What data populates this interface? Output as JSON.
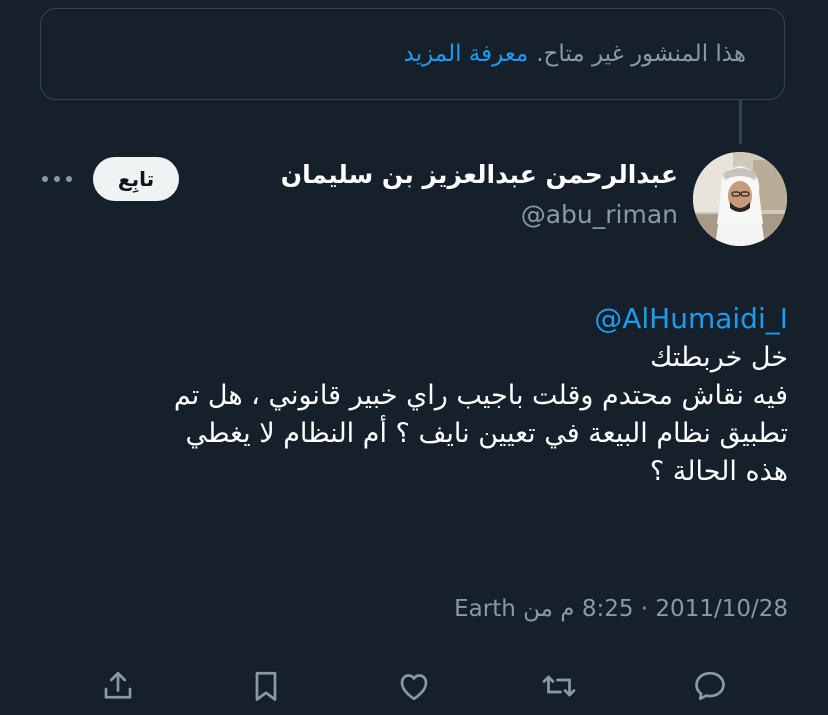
{
  "notice": {
    "message": "هذا المنشور غير متاح.",
    "link_label": "معرفة المزيد"
  },
  "author": {
    "display_name": "عبدالرحمن عبدالعزيز بن سليمان",
    "handle": "@abu_riman"
  },
  "follow_label": "تابِع",
  "more_icon": "more-horizontal-icon",
  "tweet": {
    "mention": "@AlHumaidi_I",
    "lines": [
      "خل خربطتك",
      "فيه نقاش محتدم وقلت باجيب راي خبير قانوني ، هل تم",
      "تطبيق نظام البيعة في تعيين نايف ؟ أم النظام لا يغطي",
      "هذه الحالة ؟"
    ]
  },
  "meta": {
    "date": "2011/10/28",
    "separator": "·",
    "time": "8:25 م",
    "source": "من Earth"
  },
  "actions": {
    "reply_icon": "reply-icon",
    "retweet_icon": "retweet-icon",
    "like_icon": "heart-icon",
    "bookmark_icon": "bookmark-icon",
    "share_icon": "share-icon"
  },
  "colors": {
    "background": "#15202b",
    "accent": "#1d9bf0",
    "secondary_text": "#8b98a5",
    "border": "#38444d"
  }
}
